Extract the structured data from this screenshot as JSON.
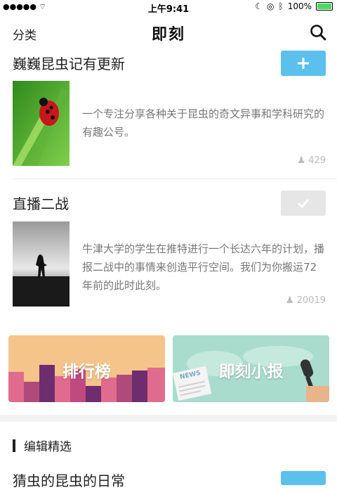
{
  "status_bar": {
    "signal": "●●●●● ",
    "time": "上午9:41",
    "battery_pct": "100%"
  },
  "navbar": {
    "left_label": "分类",
    "title": "即刻"
  },
  "cards": [
    {
      "title": "巍巍昆虫记有更新",
      "description": "一个专注分享各种关于昆虫的奇文异事和学科研究的有趣公号。",
      "count": "429",
      "followed": false
    },
    {
      "title": "直播二战",
      "description": "牛津大学的学生在推特进行一个长达六年的计划，播报二战中的事情来创造平行空间。我们为你搬运72年前的此时此刻。",
      "count": "20019",
      "followed": true
    }
  ],
  "banners": [
    {
      "label": "排行榜"
    },
    {
      "label": "即刻小报",
      "badge": "NEWS"
    }
  ],
  "section": {
    "title": "编辑精选"
  },
  "next_item": {
    "title": "猜虫的昆虫的日常"
  },
  "colors": {
    "accent": "#5bc0eb",
    "followed_bg": "#e6e6e6"
  }
}
